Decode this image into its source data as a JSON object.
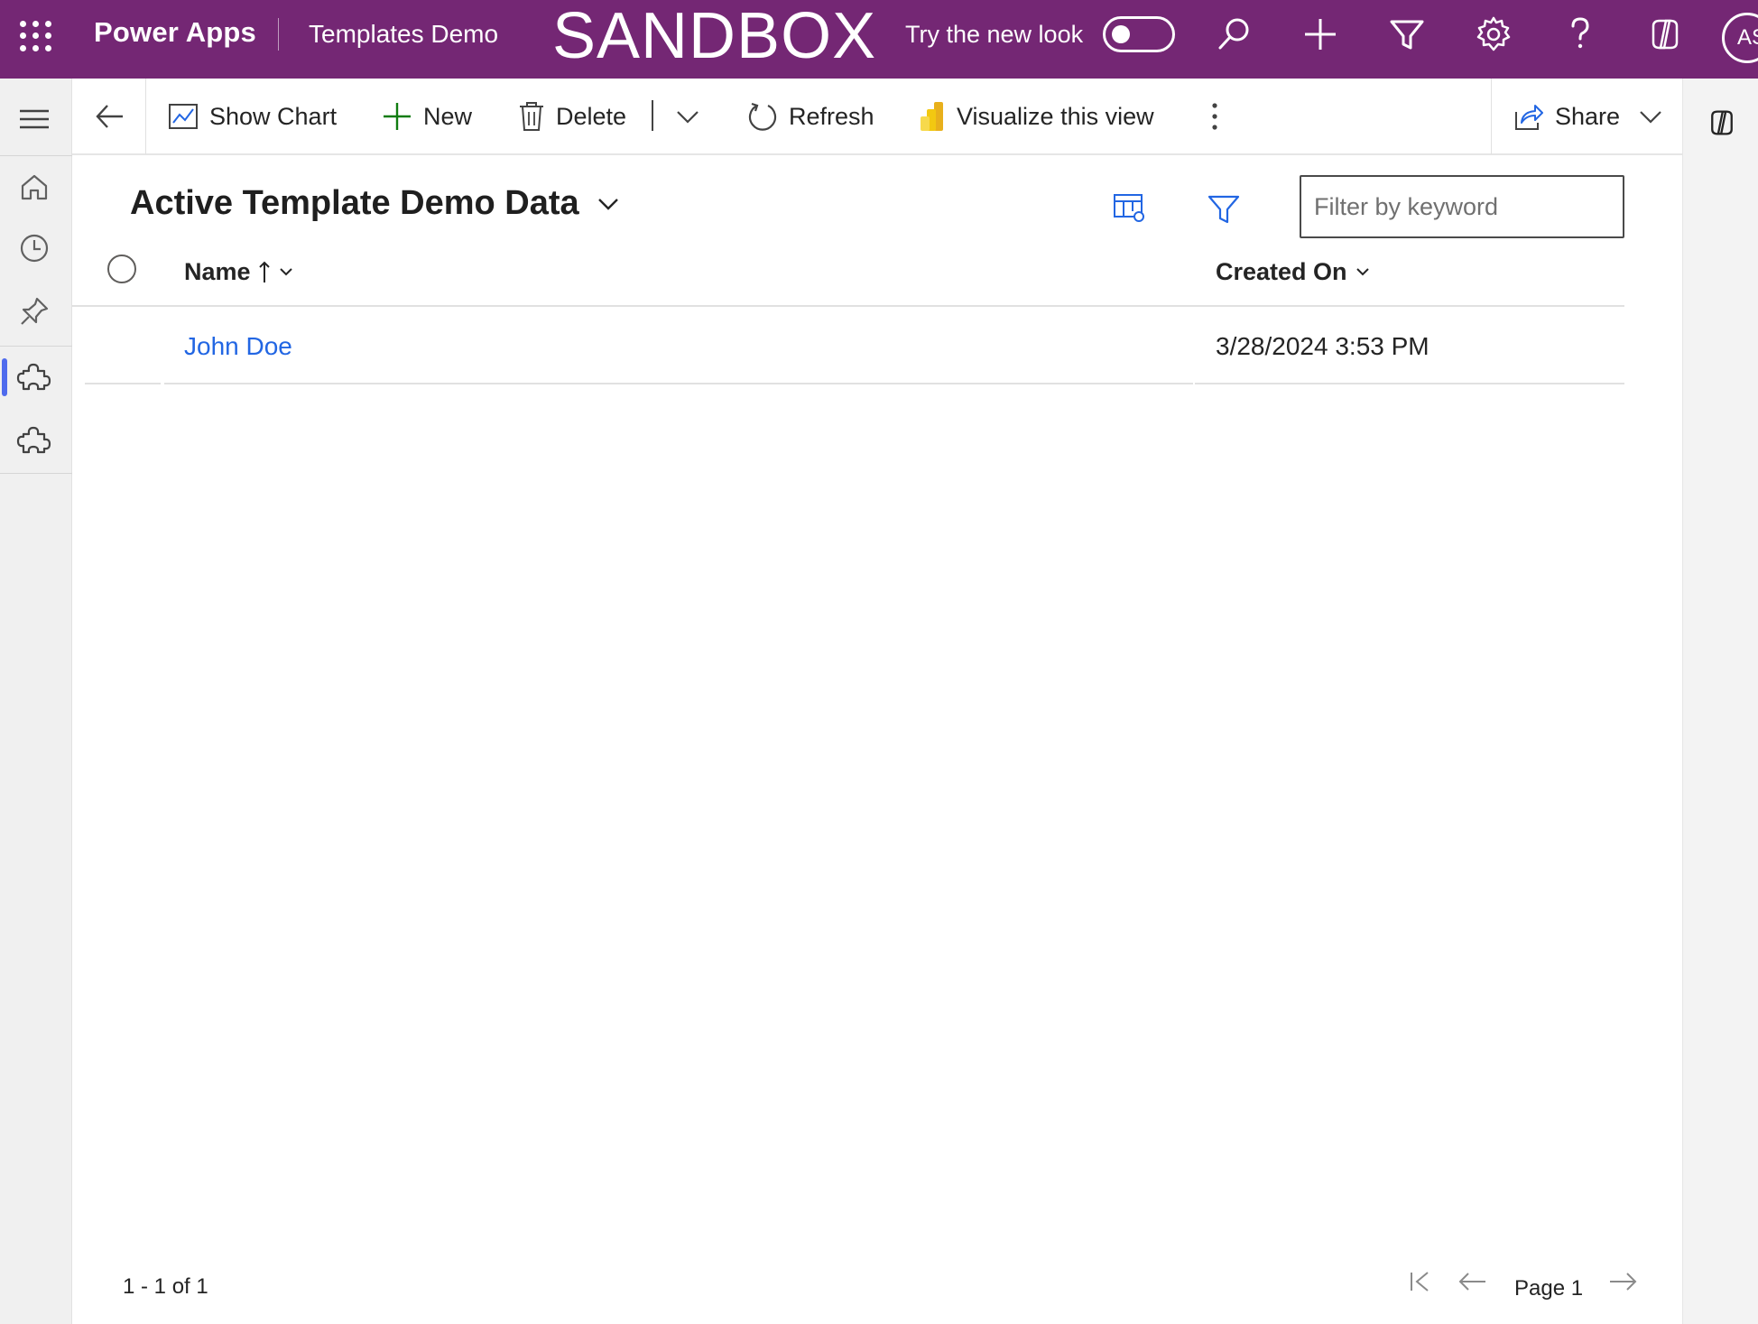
{
  "header": {
    "app_name": "Power Apps",
    "environment": "Templates Demo",
    "banner": "SANDBOX",
    "new_look_label": "Try the new look",
    "new_look_enabled": false,
    "avatar_initials": "AS",
    "brand_color": "#742774"
  },
  "commandbar": {
    "show_chart": "Show Chart",
    "new": "New",
    "delete": "Delete",
    "refresh": "Refresh",
    "visualize": "Visualize this view",
    "share": "Share"
  },
  "view": {
    "title": "Active Template Demo Data",
    "filter_placeholder": "Filter by keyword"
  },
  "grid": {
    "columns": [
      {
        "label": "Name",
        "sort": "ascending"
      },
      {
        "label": "Created On",
        "sort": "none"
      }
    ],
    "rows": [
      {
        "name": "John Doe",
        "created_on": "3/28/2024 3:53 PM"
      }
    ]
  },
  "footer": {
    "record_count": "1 - 1 of 1",
    "page_label": "Page 1"
  },
  "leftnav": {
    "items": [
      {
        "icon": "home-icon"
      },
      {
        "icon": "recent-clock-icon"
      },
      {
        "icon": "pin-icon"
      },
      {
        "icon": "puzzle-icon",
        "selected": true
      },
      {
        "icon": "puzzle-icon"
      }
    ]
  }
}
